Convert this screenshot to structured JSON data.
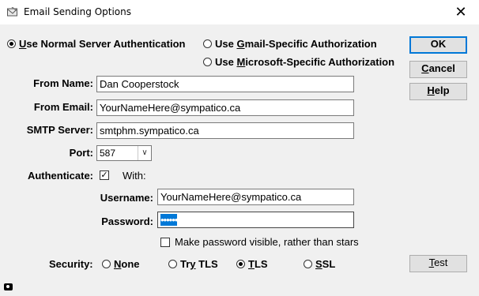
{
  "window": {
    "title": "Email Sending Options",
    "close_glyph": "✕"
  },
  "auth": {
    "normal_pre": "",
    "normal_u": "U",
    "normal_post": "se Normal Server Authentication",
    "gmail_pre": "Use ",
    "gmail_u": "G",
    "gmail_post": "mail-Specific Authorization",
    "ms_pre": "Use ",
    "ms_u": "M",
    "ms_post": "icrosoft-Specific Authorization",
    "selected": "normal"
  },
  "buttons": {
    "ok": "OK",
    "cancel_u": "C",
    "cancel_rest": "ancel",
    "help_u": "H",
    "help_rest": "elp",
    "test_pre": "",
    "test_u": "T",
    "test_post": "est"
  },
  "form": {
    "from_name_label": "From Name:",
    "from_name": "Dan Cooperstock",
    "from_email_label": "From Email:",
    "from_email": "YourNameHere@sympatico.ca",
    "smtp_label": "SMTP Server:",
    "smtp": "smtphm.sympatico.ca",
    "port_label": "Port:",
    "port": "587",
    "auth_label": "Authenticate:",
    "auth_checked": true,
    "with_label": "With:",
    "username_label": "Username:",
    "username": "YourNameHere@sympatico.ca",
    "password_label": "Password:",
    "password_mask": "••••••",
    "show_password_label": "Make password visible, rather than stars",
    "show_password_checked": false
  },
  "security": {
    "label": "Security:",
    "none_u": "N",
    "none_rest": "one",
    "trytls_pre": "Tr",
    "trytls_u": "y",
    "trytls_post": " TLS",
    "tls_u": "T",
    "tls_rest": "LS",
    "ssl_u": "S",
    "ssl_rest": "SL",
    "selected": "TLS"
  }
}
